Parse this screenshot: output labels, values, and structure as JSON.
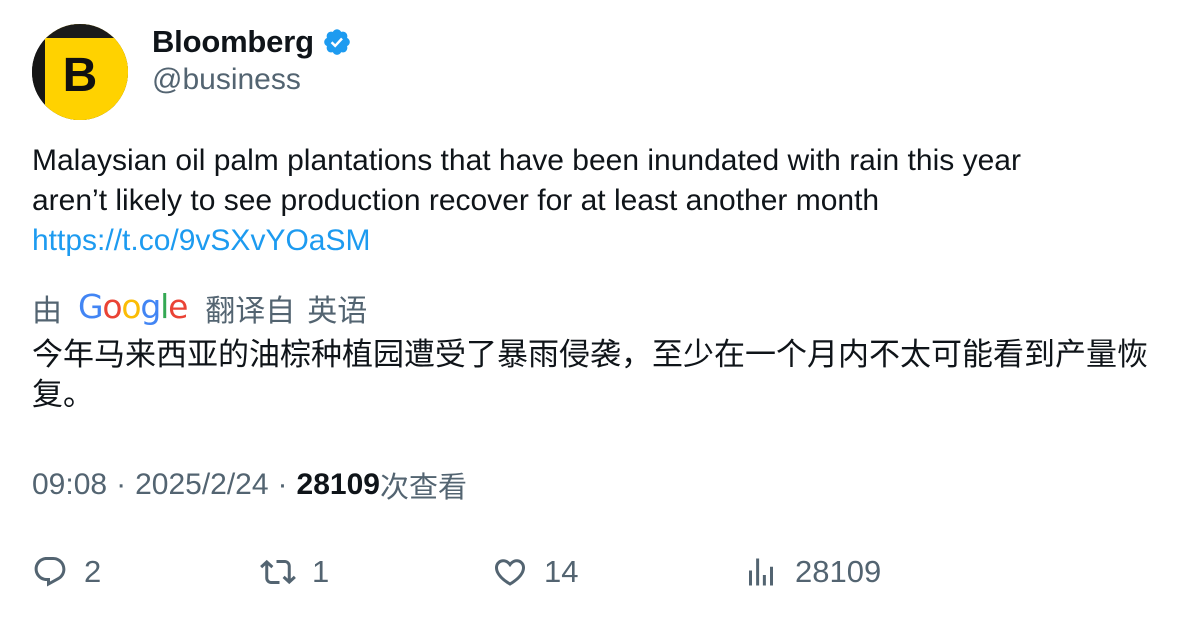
{
  "account": {
    "display_name": "Bloomberg",
    "handle": "@business",
    "verified": true,
    "avatar_letter": "B"
  },
  "tweet": {
    "text_line1": "Malaysian oil palm plantations that have been inundated with rain this year",
    "text_line2": "aren’t likely to see production recover for at least another month",
    "link": "https://t.co/9vSXvYOaSM"
  },
  "translation": {
    "prefix": "由",
    "provider_letters": [
      "G",
      "o",
      "o",
      "g",
      "l",
      "e"
    ],
    "label": "翻译自",
    "language": "英语",
    "text": "今年马来西亚的油棕种植园遭受了暴雨侵袭，至少在一个月内不太可能看到产量恢复。"
  },
  "meta": {
    "time": "09:08",
    "date": "2025/2/24",
    "separator": "·",
    "views_count": "28109",
    "views_label": "次查看"
  },
  "actions": {
    "replies": "2",
    "retweets": "1",
    "likes": "14",
    "views": "28109"
  },
  "colors": {
    "link": "#1d9bf0",
    "verified_badge": "#1d9bf0",
    "secondary_text": "#536471",
    "avatar_yellow": "#ffd200"
  },
  "icons": {
    "reply": "reply-icon",
    "retweet": "retweet-icon",
    "like": "heart-icon",
    "views": "views-chart-icon",
    "verified": "verified-badge-icon"
  }
}
